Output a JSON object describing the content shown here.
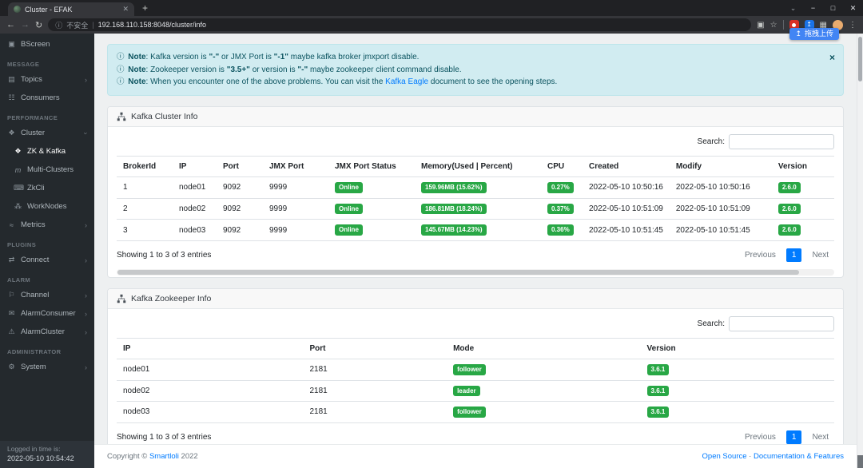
{
  "browser": {
    "tab_title": "Cluster - EFAK",
    "new_tab": "+",
    "security_label": "不安全",
    "url": "192.168.110.158:8048/cluster/info",
    "extension_tooltip": "拖拽上传"
  },
  "sidebar": {
    "bscreen_label": "BScreen",
    "message_label": "MESSAGE",
    "topics_label": "Topics",
    "consumers_label": "Consumers",
    "performance_label": "PERFORMANCE",
    "cluster_label": "Cluster",
    "zk_kafka_label": "ZK & Kafka",
    "multi_clusters_label": "Multi-Clusters",
    "zkcli_label": "ZkCli",
    "worknodes_label": "WorkNodes",
    "metrics_label": "Metrics",
    "plugins_label": "PLUGINS",
    "connect_label": "Connect",
    "alarm_label": "ALARM",
    "channel_label": "Channel",
    "alarmconsumer_label": "AlarmConsumer",
    "alarmcluster_label": "AlarmCluster",
    "administrator_label": "ADMINISTRATOR",
    "system_label": "System",
    "login_time_label": "Logged in time is:",
    "login_time_value": "2022-05-10 10:54:42"
  },
  "alert": {
    "note1": {
      "label": "Note",
      "t1": ": Kafka version is ",
      "b1": "\"-\"",
      "t2": " or JMX Port is ",
      "b2": "\"-1\"",
      "t3": " maybe kafka broker jmxport disable."
    },
    "note2": {
      "label": "Note",
      "t1": ": Zookeeper version is ",
      "b1": "\"3.5+\"",
      "t2": " or version is ",
      "b2": "\"-\"",
      "t3": " maybe zookeeper client command disable."
    },
    "note3": {
      "label": "Note",
      "t1": ": When you encounter one of the above problems. You can visit the ",
      "link": "Kafka Eagle",
      "t2": " document to see the opening steps."
    },
    "close": "×"
  },
  "cluster_panel": {
    "title": "Kafka Cluster Info",
    "search_label": "Search:",
    "columns": [
      "BrokerId",
      "IP",
      "Port",
      "JMX Port",
      "JMX Port Status",
      "Memory(Used | Percent)",
      "CPU",
      "Created",
      "Modify",
      "Version"
    ],
    "rows": [
      {
        "broker_id": "1",
        "ip": "node01",
        "port": "9092",
        "jmx_port": "9999",
        "jmx_status": "Online",
        "memory": "159.96MB (15.62%)",
        "cpu": "0.27%",
        "created": "2022-05-10 10:50:16",
        "modify": "2022-05-10 10:50:16",
        "version": "2.6.0"
      },
      {
        "broker_id": "2",
        "ip": "node02",
        "port": "9092",
        "jmx_port": "9999",
        "jmx_status": "Online",
        "memory": "186.81MB (18.24%)",
        "cpu": "0.37%",
        "created": "2022-05-10 10:51:09",
        "modify": "2022-05-10 10:51:09",
        "version": "2.6.0"
      },
      {
        "broker_id": "3",
        "ip": "node03",
        "port": "9092",
        "jmx_port": "9999",
        "jmx_status": "Online",
        "memory": "145.67MB (14.23%)",
        "cpu": "0.36%",
        "created": "2022-05-10 10:51:45",
        "modify": "2022-05-10 10:51:45",
        "version": "2.6.0"
      }
    ],
    "info": "Showing 1 to 3 of 3 entries",
    "pagination": {
      "previous": "Previous",
      "page": "1",
      "next": "Next"
    }
  },
  "zookeeper_panel": {
    "title": "Kafka Zookeeper Info",
    "search_label": "Search:",
    "columns": [
      "IP",
      "Port",
      "Mode",
      "Version"
    ],
    "rows": [
      {
        "ip": "node01",
        "port": "2181",
        "mode": "follower",
        "version": "3.6.1"
      },
      {
        "ip": "node02",
        "port": "2181",
        "mode": "leader",
        "version": "3.6.1"
      },
      {
        "ip": "node03",
        "port": "2181",
        "mode": "follower",
        "version": "3.6.1"
      }
    ],
    "info": "Showing 1 to 3 of 3 entries",
    "pagination": {
      "previous": "Previous",
      "page": "1",
      "next": "Next"
    }
  },
  "footer": {
    "copyright_prefix": "Copyright © ",
    "brand": "Smartloli",
    "copyright_suffix": " 2022",
    "open_source": "Open Source",
    "separator": " · ",
    "docs": "Documentation & Features"
  },
  "colors": {
    "accent": "#007bff",
    "success_badge": "#28a745",
    "alert_bg": "#d1ecf1",
    "alert_text": "#0c5460",
    "sidebar_bg": "#24292d",
    "chrome_bg": "#35363a"
  }
}
